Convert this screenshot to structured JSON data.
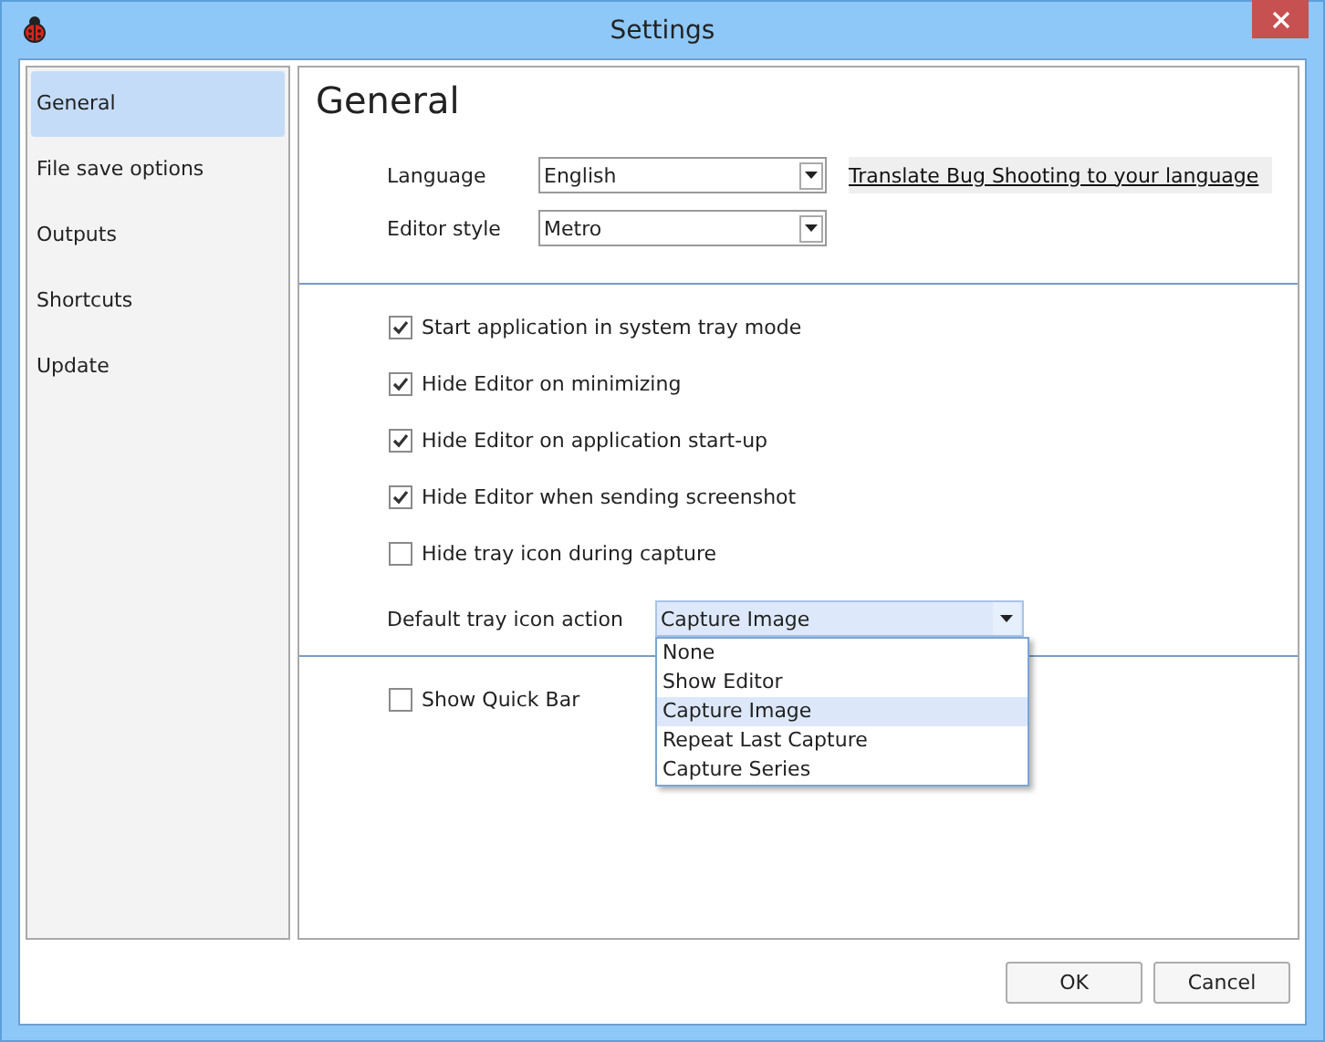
{
  "window": {
    "title": "Settings"
  },
  "sidebar": {
    "items": [
      {
        "label": "General",
        "selected": true
      },
      {
        "label": "File save options",
        "selected": false
      },
      {
        "label": "Outputs",
        "selected": false
      },
      {
        "label": "Shortcuts",
        "selected": false
      },
      {
        "label": "Update",
        "selected": false
      }
    ]
  },
  "page": {
    "title": "General",
    "language": {
      "label": "Language",
      "value": "English",
      "link": "Translate Bug Shooting to your language"
    },
    "editor_style": {
      "label": "Editor style",
      "value": "Metro"
    },
    "options": [
      {
        "label": "Start application in system tray mode",
        "checked": true
      },
      {
        "label": "Hide Editor on minimizing",
        "checked": true
      },
      {
        "label": "Hide Editor on application start-up",
        "checked": true
      },
      {
        "label": "Hide Editor when sending screenshot",
        "checked": true
      },
      {
        "label": "Hide tray icon during capture",
        "checked": false
      }
    ],
    "tray_action": {
      "label": "Default tray icon action",
      "value": "Capture Image",
      "expanded": true,
      "options": [
        {
          "label": "None",
          "selected": false
        },
        {
          "label": "Show Editor",
          "selected": false
        },
        {
          "label": "Capture Image",
          "selected": true
        },
        {
          "label": "Repeat Last Capture",
          "selected": false
        },
        {
          "label": "Capture Series",
          "selected": false
        }
      ]
    },
    "quick_bar": {
      "label": "Show Quick Bar",
      "checked": false
    }
  },
  "buttons": [
    "OK",
    "Cancel"
  ]
}
